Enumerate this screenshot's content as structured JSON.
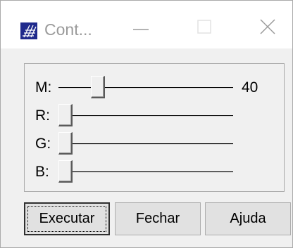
{
  "window": {
    "title": "Cont...",
    "icons": {
      "app": "rgb-palette-icon",
      "minimize": "minimize-icon",
      "maximize": "maximize-icon",
      "close": "close-icon"
    }
  },
  "sliders": [
    {
      "label": "M:",
      "value": "40",
      "position": 0.2
    },
    {
      "label": "R:",
      "value": "",
      "position": 0
    },
    {
      "label": "G:",
      "value": "",
      "position": 0
    },
    {
      "label": "B:",
      "value": "",
      "position": 0
    }
  ],
  "buttons": {
    "execute": "Executar",
    "close": "Fechar",
    "help": "Ajuda"
  }
}
